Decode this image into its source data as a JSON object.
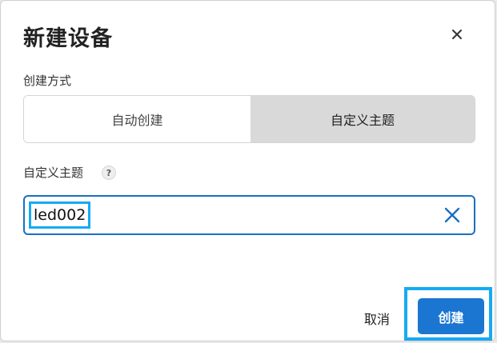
{
  "dialog": {
    "title": "新建设备",
    "close_icon": "close-icon",
    "creation_method": {
      "label": "创建方式",
      "options": [
        "自动创建",
        "自定义主题"
      ],
      "selected": "自定义主题"
    },
    "custom_topic": {
      "label": "自定义主题",
      "help_glyph": "?",
      "value": "led002",
      "clear_icon": "clear-x-icon"
    },
    "buttons": {
      "cancel": "取消",
      "create": "创建"
    }
  },
  "colors": {
    "accent": "#1b76d2",
    "input_border": "#1b6fc2",
    "highlight": "#16aaf4",
    "selected_segment": "#d9d9d9"
  }
}
